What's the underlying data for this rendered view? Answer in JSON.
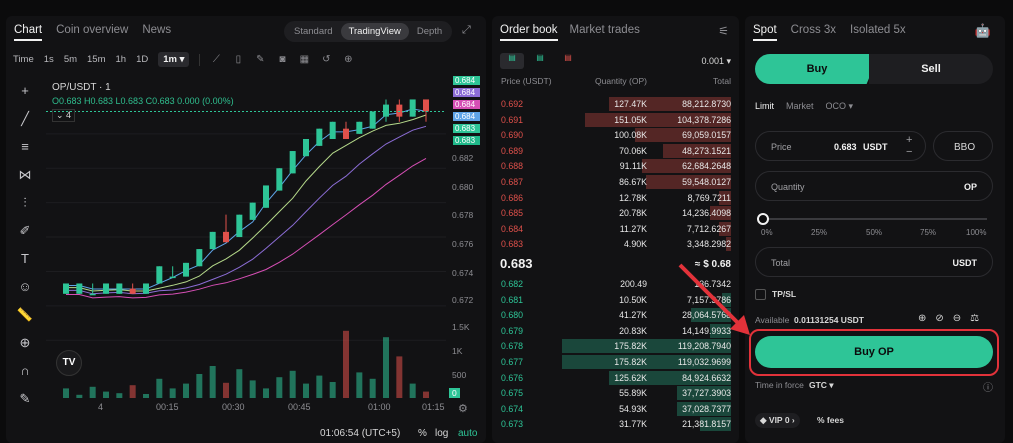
{
  "chart_tabs": [
    "Chart",
    "Coin overview",
    "News"
  ],
  "view_modes": [
    "Standard",
    "TradingView",
    "Depth"
  ],
  "timeframes": [
    "Time",
    "1s",
    "5m",
    "15m",
    "1h",
    "1D",
    "1m ▾"
  ],
  "symbol": "OP/USDT · 1",
  "ohlc": "O0.683 H0.683 L0.683 C0.683 0.000 (0.00%)",
  "indicator_box": "4",
  "price_ticks": [
    "0.682",
    "0.680",
    "0.678",
    "0.676",
    "0.674",
    "0.672"
  ],
  "price_tags": [
    "0.684",
    "0.684",
    "0.684",
    "0.684",
    "0.683",
    "0.683"
  ],
  "volume_ticks": [
    "1.5K",
    "1K",
    "500",
    "0"
  ],
  "time_ticks": [
    "4",
    "00:15",
    "00:30",
    "00:45",
    "01:00",
    "01:15"
  ],
  "clock": "01:06:54 (UTC+5)",
  "chart_options": [
    "%",
    "log",
    "auto"
  ],
  "orderbook": {
    "tabs": [
      "Order book",
      "Market trades"
    ],
    "precision": "0.001 ▾",
    "columns": [
      "Price (USDT)",
      "Quantity (OP)",
      "Total"
    ],
    "asks": [
      [
        "0.692",
        "127.47K",
        "88,212.8730",
        0.52
      ],
      [
        "0.691",
        "151.05K",
        "104,378.7286",
        0.62
      ],
      [
        "0.690",
        "100.08K",
        "69,059.0157",
        0.41
      ],
      [
        "0.689",
        "70.06K",
        "48,273.1521",
        0.29
      ],
      [
        "0.688",
        "91.11K",
        "62,684.2648",
        0.38
      ],
      [
        "0.687",
        "86.67K",
        "59,548.0127",
        0.36
      ],
      [
        "0.686",
        "12.78K",
        "8,769.7211",
        0.05
      ],
      [
        "0.685",
        "20.78K",
        "14,236.4098",
        0.09
      ],
      [
        "0.684",
        "11.27K",
        "7,712.6267",
        0.05
      ],
      [
        "0.683",
        "4.90K",
        "3,348.2982",
        0.02
      ]
    ],
    "mid_price": "0.683",
    "mid_usd": "≈ $ 0.68",
    "bids": [
      [
        "0.682",
        "200.49",
        "136.7342",
        0.0
      ],
      [
        "0.681",
        "10.50K",
        "7,157.3786",
        0.04
      ],
      [
        "0.680",
        "41.27K",
        "28,064.5768",
        0.17
      ],
      [
        "0.679",
        "20.83K",
        "14,149.9933",
        0.09
      ],
      [
        "0.678",
        "175.82K",
        "119,208.7940",
        0.72
      ],
      [
        "0.677",
        "175.82K",
        "119,032.9699",
        0.72
      ],
      [
        "0.676",
        "125.62K",
        "84,924.6632",
        0.52
      ],
      [
        "0.675",
        "55.89K",
        "37,727.3903",
        0.23
      ],
      [
        "0.674",
        "54.93K",
        "37,028.7377",
        0.23
      ],
      [
        "0.673",
        "31.77K",
        "21,381.8157",
        0.13
      ]
    ]
  },
  "trade": {
    "tabs": [
      "Spot",
      "Cross 3x",
      "Isolated 5x"
    ],
    "buy": "Buy",
    "sell": "Sell",
    "order_types": [
      "Limit",
      "Market",
      "OCO ▾"
    ],
    "price_label": "Price",
    "price_value": "0.683",
    "price_unit": "USDT",
    "bbo": "BBO",
    "quantity_label": "Quantity",
    "quantity_unit": "OP",
    "slider_marks": [
      "0%",
      "25%",
      "50%",
      "75%",
      "100%"
    ],
    "total_label": "Total",
    "total_unit": "USDT",
    "tpsl": "TP/SL",
    "available_label": "Available",
    "available_value": "0.01131254 USDT",
    "buy_button": "Buy OP",
    "time_in_force_label": "Time in force",
    "time_in_force_value": "GTC ▾",
    "vip": "VIP 0",
    "fees": "% fees"
  },
  "colors": {
    "up": "#2ec597",
    "down": "#e0514b"
  },
  "candles": [
    [
      0,
      0.6727,
      0.6733,
      0.6727,
      0.6733
    ],
    [
      1,
      0.6727,
      0.6733,
      0.6727,
      0.6733
    ],
    [
      2,
      0.6727,
      0.6733,
      0.6727,
      0.6727
    ],
    [
      3,
      0.6727,
      0.6733,
      0.6727,
      0.6733
    ],
    [
      4,
      0.6727,
      0.6733,
      0.6727,
      0.6733
    ],
    [
      5,
      0.673,
      0.6733,
      0.6727,
      0.6727
    ],
    [
      6,
      0.6727,
      0.6733,
      0.6727,
      0.6733
    ],
    [
      7,
      0.6733,
      0.6743,
      0.6733,
      0.6743
    ],
    [
      8,
      0.6737,
      0.6743,
      0.6737,
      0.6737
    ],
    [
      9,
      0.6737,
      0.6745,
      0.6737,
      0.6745
    ],
    [
      10,
      0.6743,
      0.6753,
      0.6743,
      0.6753
    ],
    [
      11,
      0.6753,
      0.6763,
      0.6753,
      0.6763
    ],
    [
      12,
      0.6763,
      0.6773,
      0.6757,
      0.6757
    ],
    [
      13,
      0.676,
      0.6773,
      0.676,
      0.6773
    ],
    [
      14,
      0.677,
      0.678,
      0.677,
      0.678
    ],
    [
      15,
      0.6777,
      0.679,
      0.6777,
      0.679
    ],
    [
      16,
      0.6787,
      0.68,
      0.6787,
      0.68
    ],
    [
      17,
      0.6797,
      0.681,
      0.6797,
      0.681
    ],
    [
      18,
      0.6807,
      0.6817,
      0.6807,
      0.6817
    ],
    [
      19,
      0.6813,
      0.6823,
      0.6813,
      0.6823
    ],
    [
      20,
      0.6817,
      0.6827,
      0.6817,
      0.6827
    ],
    [
      21,
      0.6823,
      0.6827,
      0.6817,
      0.6817
    ],
    [
      22,
      0.682,
      0.6827,
      0.682,
      0.6827
    ],
    [
      23,
      0.6823,
      0.6833,
      0.6823,
      0.6833
    ],
    [
      24,
      0.683,
      0.684,
      0.6827,
      0.6837
    ],
    [
      25,
      0.6837,
      0.684,
      0.6827,
      0.683
    ],
    [
      26,
      0.683,
      0.684,
      0.683,
      0.684
    ],
    [
      27,
      0.684,
      0.684,
      0.6827,
      0.6833
    ]
  ],
  "volumes": [
    60,
    20,
    70,
    40,
    30,
    80,
    25,
    120,
    60,
    90,
    150,
    200,
    95,
    180,
    110,
    60,
    130,
    170,
    90,
    140,
    100,
    420,
    160,
    120,
    380,
    260,
    90,
    40
  ]
}
